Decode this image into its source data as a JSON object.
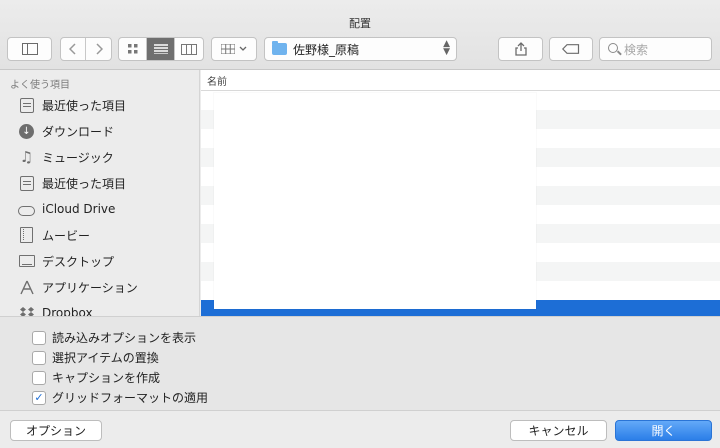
{
  "window": {
    "title": "配置"
  },
  "toolbar": {
    "path_folder": "佐野様_原稿",
    "search_placeholder": "検索"
  },
  "sidebar": {
    "section_title": "よく使う項目",
    "items": [
      {
        "label": "最近使った項目",
        "icon": "recents-icon"
      },
      {
        "label": "ダウンロード",
        "icon": "download-icon"
      },
      {
        "label": "ミュージック",
        "icon": "music-icon"
      },
      {
        "label": "最近使った項目",
        "icon": "recents-icon"
      },
      {
        "label": "iCloud Drive",
        "icon": "cloud-icon"
      },
      {
        "label": "ムービー",
        "icon": "movies-icon"
      },
      {
        "label": "デスクトップ",
        "icon": "desktop-icon"
      },
      {
        "label": "アプリケーション",
        "icon": "applications-icon"
      },
      {
        "label": "Dropbox",
        "icon": "dropbox-icon"
      }
    ]
  },
  "file_list": {
    "column_name": "名前"
  },
  "options": [
    {
      "label": "読み込みオプションを表示",
      "checked": false
    },
    {
      "label": "選択アイテムの置換",
      "checked": false
    },
    {
      "label": "キャプションを作成",
      "checked": false
    },
    {
      "label": "グリッドフォーマットの適用",
      "checked": true
    }
  ],
  "footer": {
    "options_button": "オプション",
    "cancel_button": "キャンセル",
    "open_button": "開く"
  },
  "colors": {
    "accent": "#1d6ed6",
    "folder": "#6fb3ee"
  }
}
